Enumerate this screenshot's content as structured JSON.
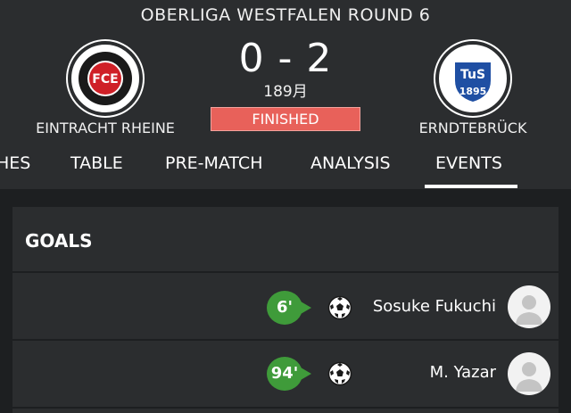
{
  "match": {
    "league_round": "OBERLIGA  WESTFALEN ROUND 6",
    "score": "0 - 2",
    "date": "189月",
    "status": "FINISHED",
    "home": {
      "name": "EINTRACHT RHEINE",
      "crest": "FCE"
    },
    "away": {
      "name": "ERNDTEBRÜCK",
      "crest": "TuS",
      "crest_year": "1895"
    }
  },
  "tabs": [
    "HES",
    "TABLE",
    "PRE-MATCH",
    "ANALYSIS",
    "EVENTS"
  ],
  "active_tab": "EVENTS",
  "goals": {
    "title": "GOALS",
    "items": [
      {
        "minute": "6'",
        "scorer": "Sosuke Fukuchi",
        "icon": "soccer-ball-icon"
      },
      {
        "minute": "94'",
        "scorer": "M. Yazar",
        "icon": "soccer-ball-icon"
      }
    ]
  },
  "colors": {
    "status": "#e8615a",
    "minute_badge": "#3f9b3a",
    "header": "#2b2d2f",
    "background": "#1d1f21"
  }
}
